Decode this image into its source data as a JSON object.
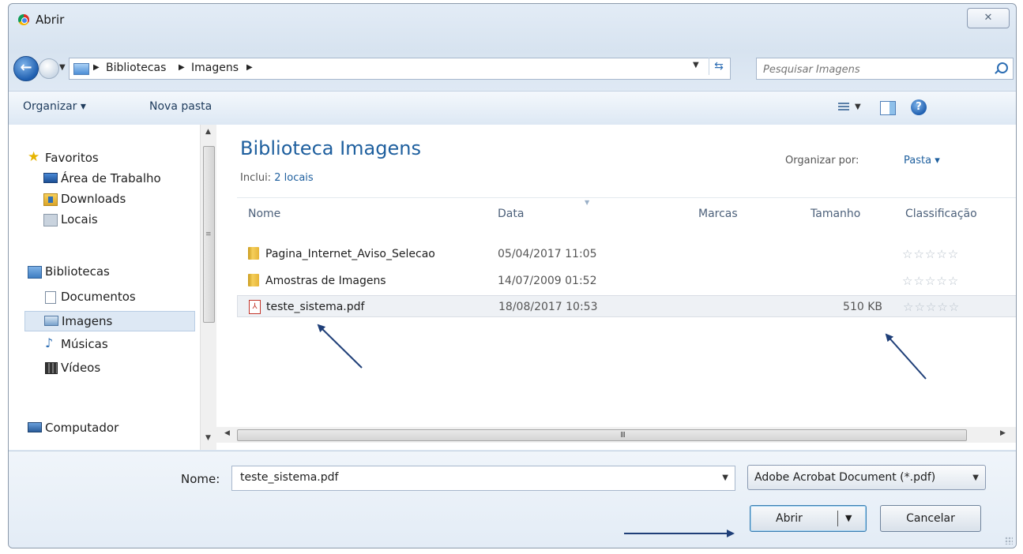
{
  "window": {
    "title": "Abrir",
    "close_glyph": "✕"
  },
  "address": {
    "crumbs": [
      "Bibliotecas",
      "Imagens"
    ],
    "search_placeholder": "Pesquisar Imagens"
  },
  "toolbar": {
    "organize": "Organizar ▾",
    "new_folder": "Nova pasta"
  },
  "nav": {
    "favorites": {
      "label": "Favoritos",
      "items": [
        "Área de Trabalho",
        "Downloads",
        "Locais"
      ]
    },
    "libraries": {
      "label": "Bibliotecas",
      "items": [
        "Documentos",
        "Imagens",
        "Músicas",
        "Vídeos"
      ]
    },
    "computer": {
      "label": "Computador"
    },
    "selected": "Imagens"
  },
  "library": {
    "title": "Biblioteca Imagens",
    "includes_label": "Inclui:",
    "includes_link": "2 locais",
    "arrange_label": "Organizar por:",
    "arrange_value": "Pasta ▾"
  },
  "columns": [
    "Nome",
    "Data",
    "Marcas",
    "Tamanho",
    "Classificação"
  ],
  "files": [
    {
      "name": "Pagina_Internet_Aviso_Selecao",
      "date": "05/04/2017 11:05",
      "tags": "",
      "size": "",
      "type": "folder",
      "rating": "☆☆☆☆☆"
    },
    {
      "name": "Amostras de Imagens",
      "date": "14/07/2009 01:52",
      "tags": "",
      "size": "",
      "type": "folder",
      "rating": "☆☆☆☆☆"
    },
    {
      "name": "teste_sistema.pdf",
      "date": "18/08/2017 10:53",
      "tags": "",
      "size": "510 KB",
      "type": "pdf",
      "rating": "☆☆☆☆☆",
      "selected": true
    }
  ],
  "hscroll_grip": "III",
  "footer": {
    "filename_label": "Nome:",
    "filename_value": "teste_sistema.pdf",
    "filter": "Adobe Acrobat Document (*.pdf)",
    "open": "Abrir",
    "cancel": "Cancelar"
  },
  "colors": {
    "accent": "#1e5f9e",
    "annotation_arrow": "#1f3f78"
  }
}
